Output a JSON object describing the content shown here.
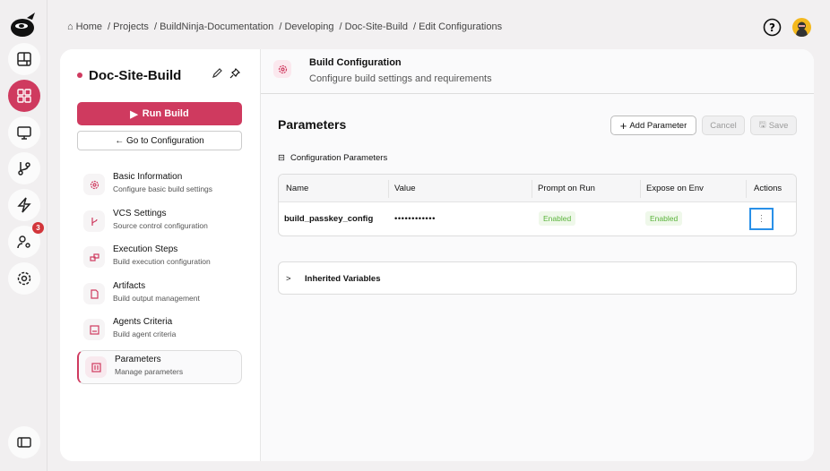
{
  "breadcrumb": [
    "Home",
    "Projects",
    "BuildNinja-Documentation",
    "Developing",
    "Doc-Site-Build",
    "Edit Configurations"
  ],
  "rail": {
    "notification_count": "3",
    "accent": "#cf3a5f"
  },
  "build": {
    "name": "Doc-Site-Build",
    "run_label": "Run Build",
    "goto_label": "← Go to Configuration"
  },
  "nav": [
    {
      "title": "Basic Information",
      "sub": "Configure basic build settings",
      "icon": "gear-icon"
    },
    {
      "title": "VCS Settings",
      "sub": "Source control configuration",
      "icon": "git-branch-icon"
    },
    {
      "title": "Execution Steps",
      "sub": "Build execution configuration",
      "icon": "steps-icon"
    },
    {
      "title": "Artifacts",
      "sub": "Build output management",
      "icon": "file-icon"
    },
    {
      "title": "Agents Criteria",
      "sub": "Build agent criteria",
      "icon": "agent-icon"
    },
    {
      "title": "Parameters",
      "sub": "Manage parameters",
      "icon": "sliders-icon"
    }
  ],
  "header": {
    "title": "Build Configuration",
    "subtitle": "Configure build settings and requirements"
  },
  "params": {
    "title": "Parameters",
    "add": "Add Parameter",
    "cancel": "Cancel",
    "save": "Save",
    "section": "Configuration Parameters",
    "columns": [
      "Name",
      "Value",
      "Prompt on Run",
      "Expose on Env",
      "Actions"
    ],
    "rows": [
      {
        "name": "build_passkey_config",
        "value": "••••••••••••",
        "prompt": "Enabled",
        "expose": "Enabled"
      }
    ],
    "inherited": "Inherited Variables"
  }
}
